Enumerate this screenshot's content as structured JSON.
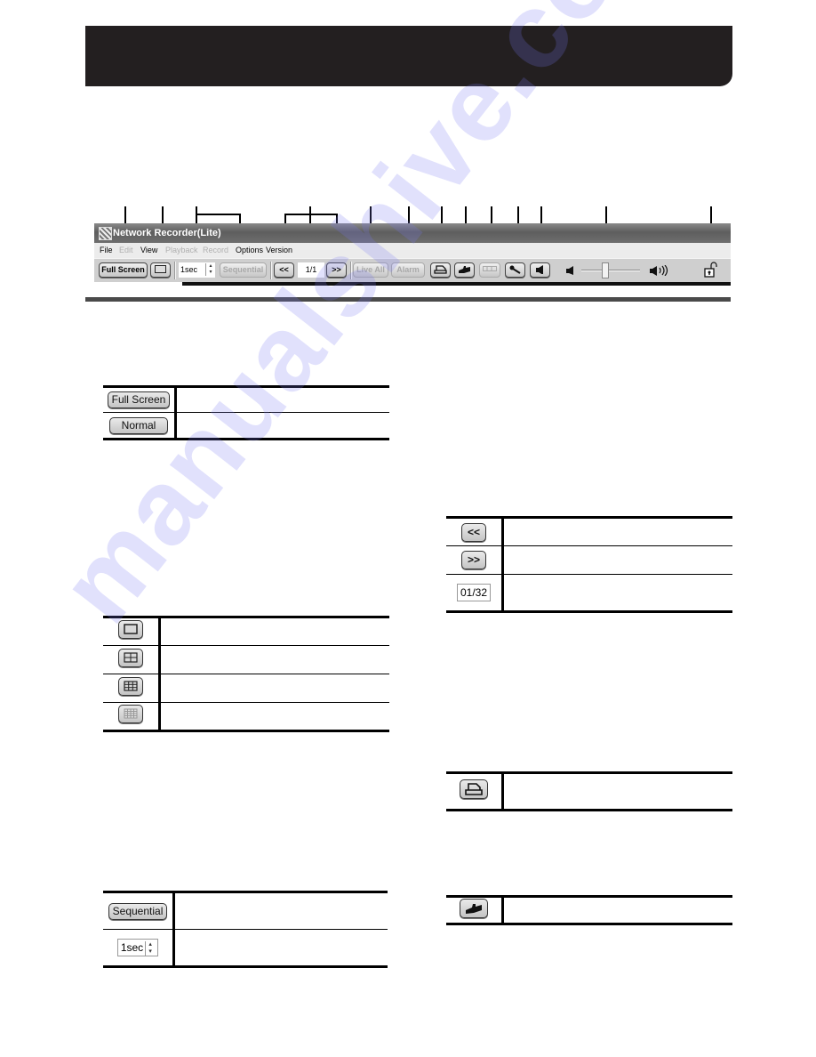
{
  "app_window": {
    "title": "Network Recorder(Lite)",
    "menu": [
      {
        "label": "File",
        "enabled": true
      },
      {
        "label": "Edit",
        "enabled": false
      },
      {
        "label": "View",
        "enabled": true
      },
      {
        "label": "Playback",
        "enabled": false
      },
      {
        "label": "Record",
        "enabled": false
      },
      {
        "label": "Options",
        "enabled": true
      },
      {
        "label": "Version",
        "enabled": true
      }
    ],
    "toolbar": {
      "full_screen_label": "Full Screen",
      "interval_value": "1sec",
      "sequential_label": "Sequential",
      "prev_page_label": "<<",
      "page_value": "1/1",
      "next_page_label": ">>",
      "live_all_label": "Live All",
      "alarm_label": "Alarm",
      "icons": [
        "single-screen-icon",
        "print-icon",
        "camera-icon",
        "display-icon",
        "microphone-icon",
        "speaker-icon",
        "volume-low-icon",
        "volume-high-icon",
        "lock-icon"
      ],
      "volume_level_percent": 40
    }
  },
  "watermark": "manualshive.com",
  "tables": {
    "screen_mode": [
      {
        "button": "Full Screen",
        "description": ""
      },
      {
        "button": "Normal",
        "description": ""
      }
    ],
    "split_screen": [
      {
        "icon": "single-screen-icon",
        "description": ""
      },
      {
        "icon": "quad-screen-icon",
        "description": ""
      },
      {
        "icon": "nine-screen-icon",
        "description": ""
      },
      {
        "icon": "sixteen-screen-icon",
        "description": ""
      }
    ],
    "sequence": [
      {
        "button": "Sequential",
        "description": ""
      },
      {
        "field_value": "1sec",
        "description": ""
      }
    ],
    "paging": [
      {
        "button": "<<",
        "description": ""
      },
      {
        "button": ">>",
        "description": ""
      },
      {
        "field_value": "01/32",
        "description": ""
      }
    ],
    "print": [
      {
        "icon": "print-icon",
        "description": ""
      }
    ],
    "snapshot": [
      {
        "icon": "camera-icon",
        "description": ""
      }
    ]
  }
}
